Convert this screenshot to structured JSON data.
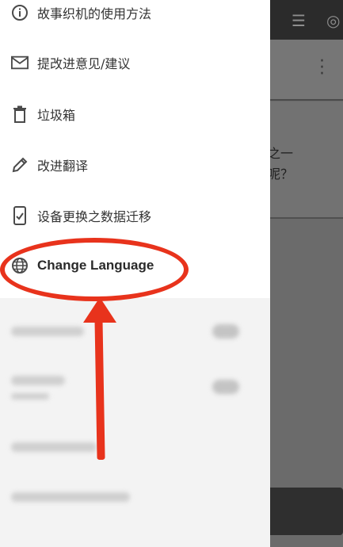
{
  "background": {
    "text_lines": [
      "之一",
      "呢？"
    ]
  },
  "drawer": {
    "items": [
      {
        "label": "故事织机的使用方法",
        "icon": "info-icon"
      },
      {
        "label": "提改进意见/建议",
        "icon": "mail-icon"
      },
      {
        "label": "垃圾箱",
        "icon": "trash-icon"
      },
      {
        "label": "改进翻译",
        "icon": "pencil-icon"
      },
      {
        "label": "设备更换之数据迁移",
        "icon": "device-transfer-icon"
      },
      {
        "label": "Change Language",
        "icon": "globe-icon"
      }
    ]
  },
  "annotation": {
    "color": "#e8331c",
    "highlighted_item": "Change Language"
  }
}
